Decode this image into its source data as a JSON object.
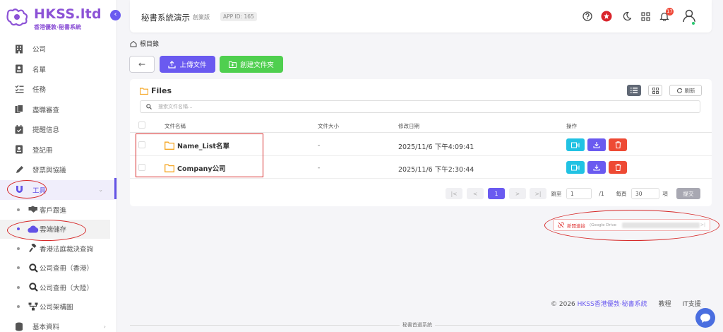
{
  "sidebar": {
    "logo_title": "HKSS.ltd",
    "logo_subtitle": "香港優敦·秘書系統",
    "items": [
      {
        "label": "公司",
        "icon": "building-icon"
      },
      {
        "label": "名單",
        "icon": "contact-card-icon"
      },
      {
        "label": "任務",
        "icon": "checklist-icon"
      },
      {
        "label": "盡職審查",
        "icon": "documents-icon"
      },
      {
        "label": "提醒信息",
        "icon": "calendar-check-icon"
      },
      {
        "label": "登記冊",
        "icon": "register-book-icon"
      },
      {
        "label": "發票與協議",
        "icon": "pen-icon"
      },
      {
        "label": "工具",
        "icon": "magnet-icon"
      }
    ],
    "sub_items": [
      {
        "label": "客戶跟進",
        "icon": "handshake-icon"
      },
      {
        "label": "雲端儲存",
        "icon": "cloud-icon"
      },
      {
        "label": "香港法庭裁決查詢",
        "icon": "gavel-icon"
      },
      {
        "label": "公司查冊（香港）",
        "icon": "search-icon"
      },
      {
        "label": "公司查冊（大陸）",
        "icon": "search-icon"
      },
      {
        "label": "公司架構圖",
        "icon": "org-chart-icon"
      }
    ],
    "bottom_item": {
      "label": "基本資料",
      "icon": "database-icon"
    }
  },
  "topbar": {
    "title": "秘書系統演示",
    "edition": "創業版",
    "app_id": "APP ID: 165",
    "notification_count": "17"
  },
  "breadcrumb": {
    "label": "根目錄"
  },
  "toolbar": {
    "back_label": "←",
    "upload_label": "上傳文件",
    "create_folder_label": "創建文件夾"
  },
  "files": {
    "title": "Files",
    "refresh_label": "刷新",
    "search_placeholder": "搜索文件名稱...",
    "columns": {
      "name": "文件名稱",
      "size": "文件大小",
      "date": "修改日期",
      "actions": "操作"
    },
    "rows": [
      {
        "name": "Name_List名單",
        "size": "-",
        "date": "2025/11/6 下午4:09:41"
      },
      {
        "name": "Company公司",
        "size": "-",
        "date": "2025/11/6 下午2:30:44"
      }
    ]
  },
  "pagination": {
    "first": "|<",
    "prev": "<",
    "current": "1",
    "next": ">",
    "last": ">|",
    "jump_label": "跳至",
    "jump_value": "1",
    "total_pages": "/1",
    "per_page_label": "每頁",
    "per_page_value": "30",
    "unit": "項",
    "submit": "提交"
  },
  "new_link": {
    "label": "新開連接",
    "value": "(Google Drive",
    "end": ">|"
  },
  "footer": {
    "copyright": "© 2026",
    "brand": "HKSS香港優敦·秘書系統",
    "tutorial": "教程",
    "support": "IT支援",
    "bottom_text": "秘書首選系統"
  }
}
